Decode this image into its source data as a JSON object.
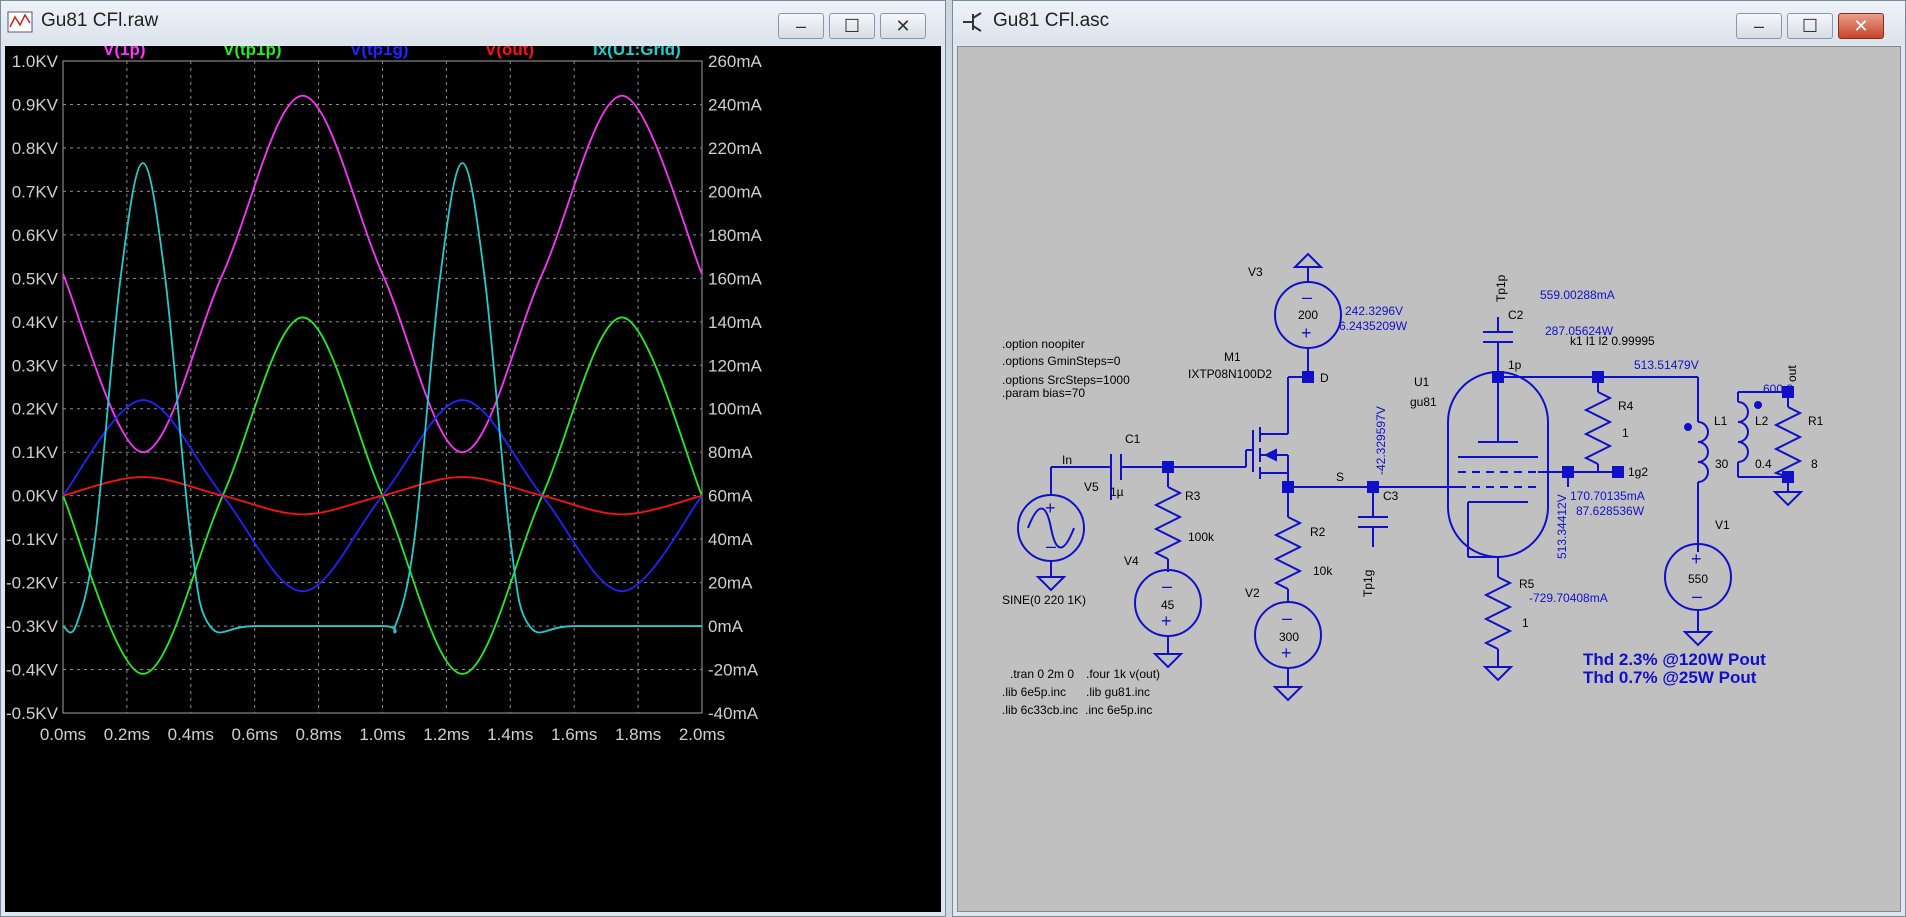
{
  "plot_window": {
    "title": "Gu81 CFl.raw",
    "buttons": {
      "minimize": "–",
      "maximize": "☐",
      "close": "✕"
    }
  },
  "schematic_window": {
    "title": "Gu81 CFl.asc",
    "buttons": {
      "minimize": "–",
      "maximize": "☐",
      "close": "✕"
    }
  },
  "chart_data": {
    "type": "line",
    "background": "#000000",
    "grid": true,
    "x": {
      "label_ticks": [
        "0.0ms",
        "0.2ms",
        "0.4ms",
        "0.6ms",
        "0.8ms",
        "1.0ms",
        "1.2ms",
        "1.4ms",
        "1.6ms",
        "1.8ms",
        "2.0ms"
      ],
      "range": [
        0,
        2
      ],
      "unit": "ms"
    },
    "y_left": {
      "ticks": [
        "1.0KV",
        "0.9KV",
        "0.8KV",
        "0.7KV",
        "0.6KV",
        "0.5KV",
        "0.4KV",
        "0.3KV",
        "0.2KV",
        "0.1KV",
        "0.0KV",
        "-0.1KV",
        "-0.2KV",
        "-0.3KV",
        "-0.4KV",
        "-0.5KV"
      ],
      "range": [
        -0.5,
        1.0
      ],
      "unit": "KV"
    },
    "y_right": {
      "ticks": [
        "260mA",
        "240mA",
        "220mA",
        "200mA",
        "180mA",
        "160mA",
        "140mA",
        "120mA",
        "100mA",
        "80mA",
        "60mA",
        "40mA",
        "20mA",
        "0mA",
        "-20mA",
        "-40mA"
      ],
      "range": [
        -40,
        260
      ],
      "unit": "mA"
    },
    "series": [
      {
        "name": "V(1p)",
        "color": "#ff33ff",
        "axis": "left",
        "x": [
          0,
          0.25,
          0.5,
          0.75,
          1.0,
          1.25,
          1.5,
          1.75,
          2.0
        ],
        "values": [
          0.51,
          0.1,
          0.51,
          0.92,
          0.51,
          0.1,
          0.51,
          0.92,
          0.51
        ]
      },
      {
        "name": "V(tp1p)",
        "color": "#22ee22",
        "axis": "left",
        "x": [
          0,
          0.25,
          0.5,
          0.75,
          1.0,
          1.25,
          1.5,
          1.75,
          2.0
        ],
        "values": [
          0.0,
          -0.41,
          0.0,
          0.41,
          0.0,
          -0.41,
          0.0,
          0.41,
          0.0
        ]
      },
      {
        "name": "V(tp1g)",
        "color": "#2222ff",
        "axis": "left",
        "x": [
          0,
          0.25,
          0.5,
          0.75,
          1.0,
          1.25,
          1.5,
          1.75,
          2.0
        ],
        "values": [
          0.0,
          0.22,
          0.0,
          -0.22,
          0.0,
          0.22,
          0.0,
          -0.22,
          0.0
        ]
      },
      {
        "name": "V(out)",
        "color": "#ff1111",
        "axis": "left",
        "x": [
          0,
          0.25,
          0.5,
          0.75,
          1.0,
          1.25,
          1.5,
          1.75,
          2.0
        ],
        "values": [
          0.0,
          0.043,
          0.0,
          -0.043,
          0.0,
          0.043,
          0.0,
          -0.043,
          0.0
        ]
      },
      {
        "name": "Ix(U1:Grid)",
        "color": "#22cccc",
        "axis": "right",
        "x": [
          0,
          0.04,
          0.1,
          0.18,
          0.25,
          0.32,
          0.4,
          0.46,
          0.6,
          1.0,
          1.04,
          1.1,
          1.18,
          1.25,
          1.32,
          1.4,
          1.46,
          1.6,
          2.0
        ],
        "values": [
          0,
          0,
          40,
          160,
          213,
          160,
          40,
          0,
          0,
          0,
          0,
          40,
          160,
          213,
          160,
          40,
          0,
          0,
          0
        ]
      }
    ]
  },
  "schematic": {
    "directives": [
      ".option noopiter",
      ".options GminSteps=0",
      ".options SrcSteps=1000",
      ".param bias=70"
    ],
    "sim_cmds": [
      ".tran 0 2m 0",
      ".four 1k v(out)",
      ".lib 6e5p.inc",
      ".lib gu81.inc",
      ".lib 6c33cb.inc",
      ".inc 6e5p.inc"
    ],
    "components": {
      "v3_name": "V3",
      "v3_val": "200",
      "m1_name": "M1",
      "m1_model": "IXTP08N100D2",
      "d_label": "D",
      "s_label": "S",
      "c1_name": "C1",
      "c1_val": "1µ",
      "in_label": "In",
      "v5_name": "V5",
      "v5_val": "SINE(0 220 1K)",
      "r3_name": "R3",
      "r3_val": "100k",
      "v4_name": "V4",
      "v4_val": "45",
      "r2_name": "R2",
      "r2_val": "10k",
      "v2_name": "V2",
      "v2_val": "300",
      "c3_name": "C3",
      "tp1g": "Tp1g",
      "u1_name": "U1",
      "u1_model": "gu81",
      "c2_name": "C2",
      "tp1p": "Tp1p",
      "r4_name": "R4",
      "r4_val": "1",
      "r5_name": "R5",
      "r5_val": "1",
      "l1_name": "L1",
      "l1_val": "30",
      "l2_name": "L2",
      "l2_val": "0.4",
      "r1_name": "R1",
      "r1_val": "8",
      "v1_name": "V1",
      "v1_val": "550",
      "ratio": "600:8",
      "coupling": "k1 l1 l2 0.99995",
      "net_1p": "1p",
      "net_1g2": "1g2",
      "net_out": "out"
    },
    "annotations": {
      "v_242": "242.3296V",
      "w_624": "6.2435209W",
      "v_neg42": "-42.329597V",
      "ma_559": "559.00288mA",
      "w_287": "287.05624W",
      "v_513a": "513.51479V",
      "v_513b": "513.34412V",
      "ma_170": "170.70135mA",
      "w_87": "87.628536W",
      "ma_neg729": "-729.70408mA"
    },
    "notes": [
      "Thd 2.3% @120W Pout",
      "Thd 0.7% @25W Pout"
    ]
  }
}
